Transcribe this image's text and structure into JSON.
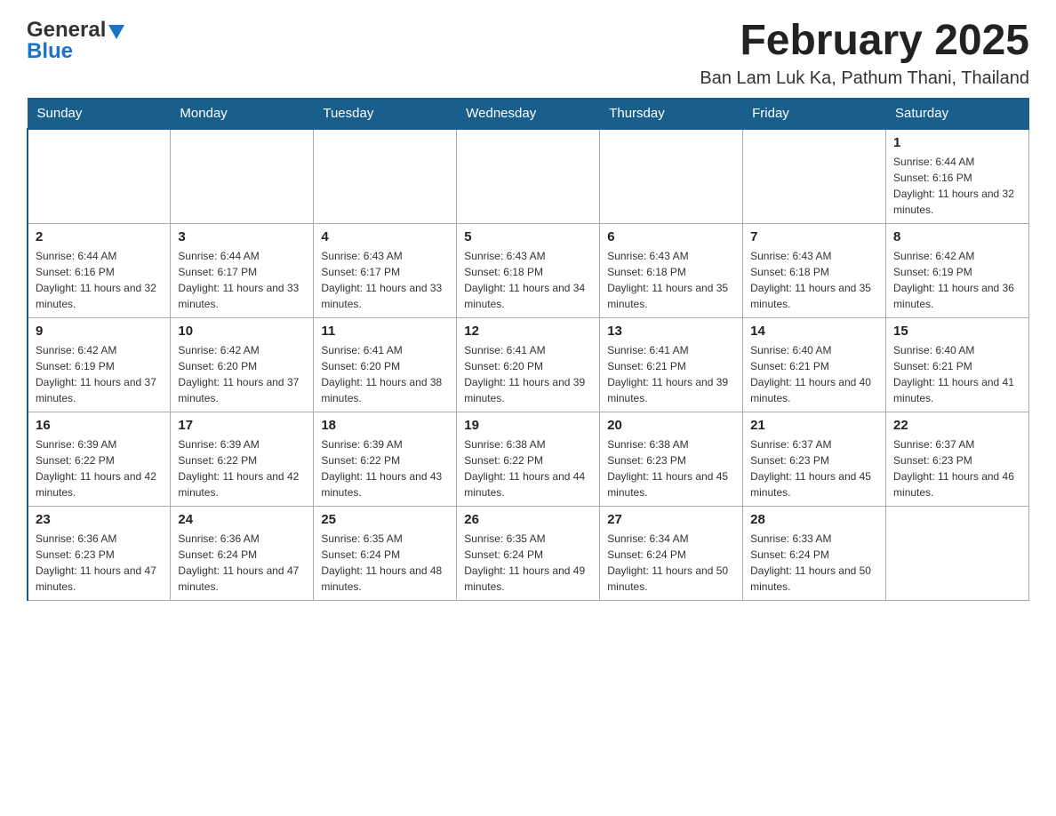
{
  "header": {
    "logo_general": "General",
    "logo_blue": "Blue",
    "month_title": "February 2025",
    "location": "Ban Lam Luk Ka, Pathum Thani, Thailand"
  },
  "days_of_week": [
    "Sunday",
    "Monday",
    "Tuesday",
    "Wednesday",
    "Thursday",
    "Friday",
    "Saturday"
  ],
  "weeks": [
    {
      "days": [
        {
          "number": "",
          "info": "",
          "empty": true
        },
        {
          "number": "",
          "info": "",
          "empty": true
        },
        {
          "number": "",
          "info": "",
          "empty": true
        },
        {
          "number": "",
          "info": "",
          "empty": true
        },
        {
          "number": "",
          "info": "",
          "empty": true
        },
        {
          "number": "",
          "info": "",
          "empty": true
        },
        {
          "number": "1",
          "info": "Sunrise: 6:44 AM\nSunset: 6:16 PM\nDaylight: 11 hours and 32 minutes.",
          "empty": false
        }
      ]
    },
    {
      "days": [
        {
          "number": "2",
          "info": "Sunrise: 6:44 AM\nSunset: 6:16 PM\nDaylight: 11 hours and 32 minutes.",
          "empty": false
        },
        {
          "number": "3",
          "info": "Sunrise: 6:44 AM\nSunset: 6:17 PM\nDaylight: 11 hours and 33 minutes.",
          "empty": false
        },
        {
          "number": "4",
          "info": "Sunrise: 6:43 AM\nSunset: 6:17 PM\nDaylight: 11 hours and 33 minutes.",
          "empty": false
        },
        {
          "number": "5",
          "info": "Sunrise: 6:43 AM\nSunset: 6:18 PM\nDaylight: 11 hours and 34 minutes.",
          "empty": false
        },
        {
          "number": "6",
          "info": "Sunrise: 6:43 AM\nSunset: 6:18 PM\nDaylight: 11 hours and 35 minutes.",
          "empty": false
        },
        {
          "number": "7",
          "info": "Sunrise: 6:43 AM\nSunset: 6:18 PM\nDaylight: 11 hours and 35 minutes.",
          "empty": false
        },
        {
          "number": "8",
          "info": "Sunrise: 6:42 AM\nSunset: 6:19 PM\nDaylight: 11 hours and 36 minutes.",
          "empty": false
        }
      ]
    },
    {
      "days": [
        {
          "number": "9",
          "info": "Sunrise: 6:42 AM\nSunset: 6:19 PM\nDaylight: 11 hours and 37 minutes.",
          "empty": false
        },
        {
          "number": "10",
          "info": "Sunrise: 6:42 AM\nSunset: 6:20 PM\nDaylight: 11 hours and 37 minutes.",
          "empty": false
        },
        {
          "number": "11",
          "info": "Sunrise: 6:41 AM\nSunset: 6:20 PM\nDaylight: 11 hours and 38 minutes.",
          "empty": false
        },
        {
          "number": "12",
          "info": "Sunrise: 6:41 AM\nSunset: 6:20 PM\nDaylight: 11 hours and 39 minutes.",
          "empty": false
        },
        {
          "number": "13",
          "info": "Sunrise: 6:41 AM\nSunset: 6:21 PM\nDaylight: 11 hours and 39 minutes.",
          "empty": false
        },
        {
          "number": "14",
          "info": "Sunrise: 6:40 AM\nSunset: 6:21 PM\nDaylight: 11 hours and 40 minutes.",
          "empty": false
        },
        {
          "number": "15",
          "info": "Sunrise: 6:40 AM\nSunset: 6:21 PM\nDaylight: 11 hours and 41 minutes.",
          "empty": false
        }
      ]
    },
    {
      "days": [
        {
          "number": "16",
          "info": "Sunrise: 6:39 AM\nSunset: 6:22 PM\nDaylight: 11 hours and 42 minutes.",
          "empty": false
        },
        {
          "number": "17",
          "info": "Sunrise: 6:39 AM\nSunset: 6:22 PM\nDaylight: 11 hours and 42 minutes.",
          "empty": false
        },
        {
          "number": "18",
          "info": "Sunrise: 6:39 AM\nSunset: 6:22 PM\nDaylight: 11 hours and 43 minutes.",
          "empty": false
        },
        {
          "number": "19",
          "info": "Sunrise: 6:38 AM\nSunset: 6:22 PM\nDaylight: 11 hours and 44 minutes.",
          "empty": false
        },
        {
          "number": "20",
          "info": "Sunrise: 6:38 AM\nSunset: 6:23 PM\nDaylight: 11 hours and 45 minutes.",
          "empty": false
        },
        {
          "number": "21",
          "info": "Sunrise: 6:37 AM\nSunset: 6:23 PM\nDaylight: 11 hours and 45 minutes.",
          "empty": false
        },
        {
          "number": "22",
          "info": "Sunrise: 6:37 AM\nSunset: 6:23 PM\nDaylight: 11 hours and 46 minutes.",
          "empty": false
        }
      ]
    },
    {
      "days": [
        {
          "number": "23",
          "info": "Sunrise: 6:36 AM\nSunset: 6:23 PM\nDaylight: 11 hours and 47 minutes.",
          "empty": false
        },
        {
          "number": "24",
          "info": "Sunrise: 6:36 AM\nSunset: 6:24 PM\nDaylight: 11 hours and 47 minutes.",
          "empty": false
        },
        {
          "number": "25",
          "info": "Sunrise: 6:35 AM\nSunset: 6:24 PM\nDaylight: 11 hours and 48 minutes.",
          "empty": false
        },
        {
          "number": "26",
          "info": "Sunrise: 6:35 AM\nSunset: 6:24 PM\nDaylight: 11 hours and 49 minutes.",
          "empty": false
        },
        {
          "number": "27",
          "info": "Sunrise: 6:34 AM\nSunset: 6:24 PM\nDaylight: 11 hours and 50 minutes.",
          "empty": false
        },
        {
          "number": "28",
          "info": "Sunrise: 6:33 AM\nSunset: 6:24 PM\nDaylight: 11 hours and 50 minutes.",
          "empty": false
        },
        {
          "number": "",
          "info": "",
          "empty": true
        }
      ]
    }
  ]
}
